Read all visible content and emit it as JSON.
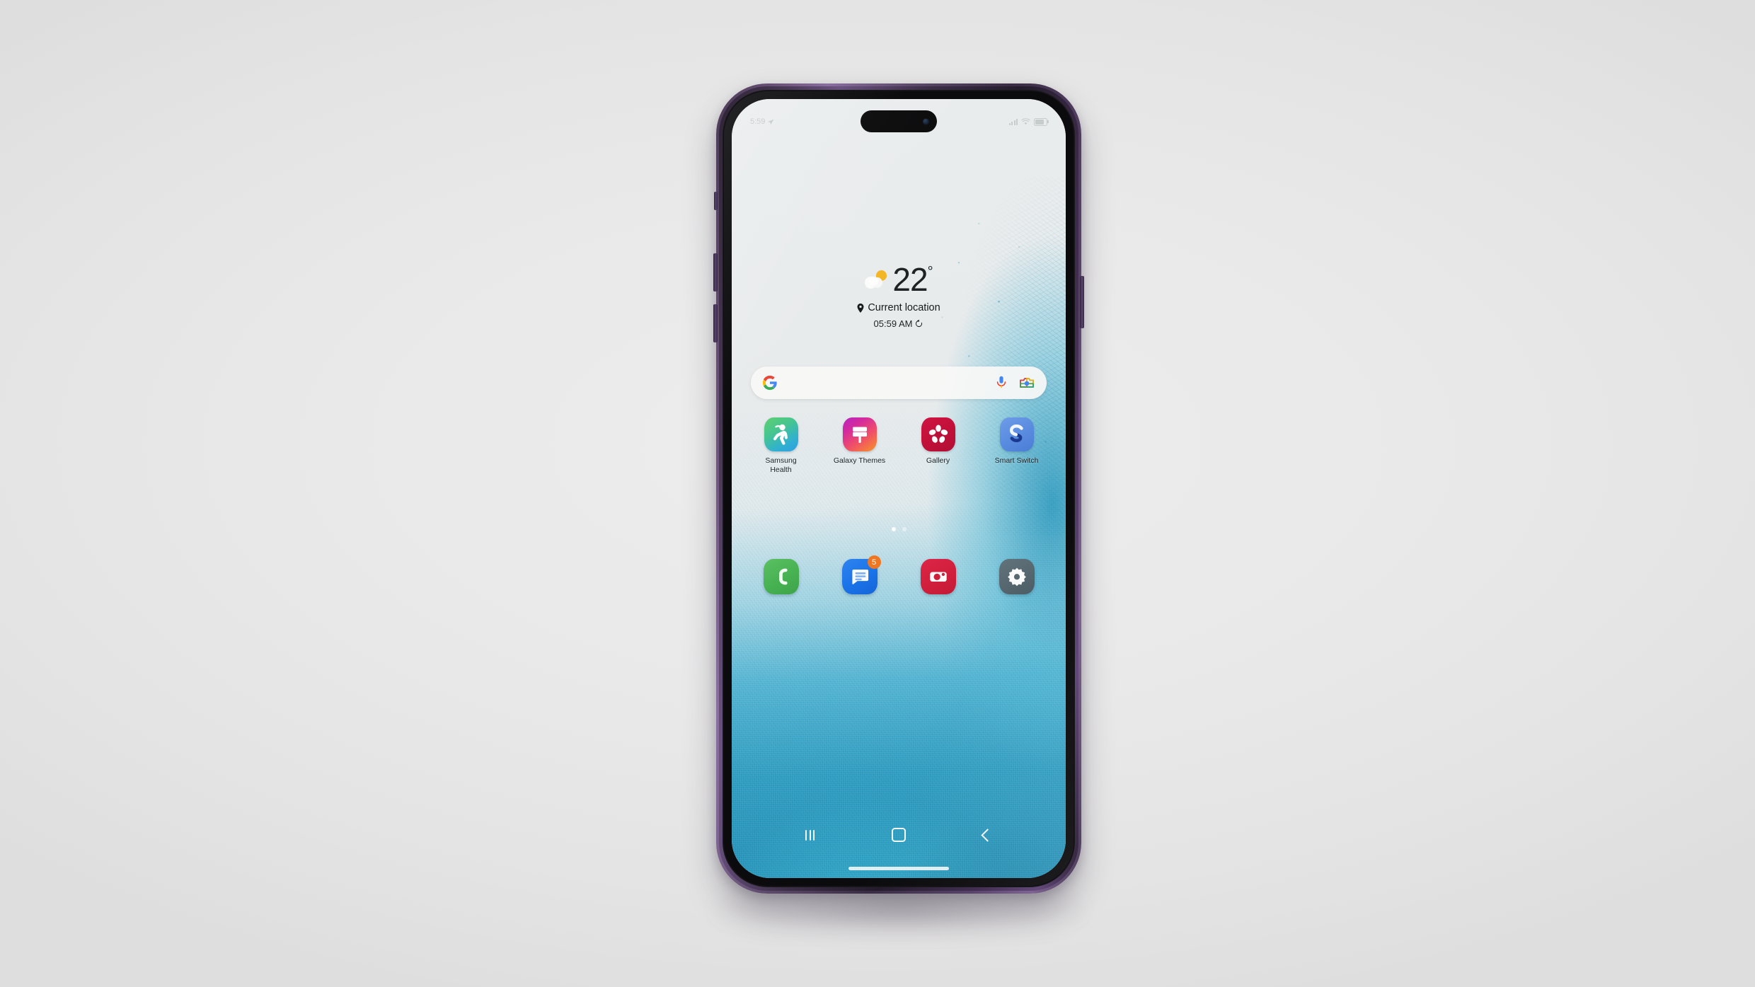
{
  "scene": {
    "subject": "smartphone-home-screen",
    "backdrop_color": "#eaeaea",
    "frame_color": "#5d4a6b"
  },
  "status_bar": {
    "time": "5:59",
    "location_icon": "location-arrow-icon",
    "signal_icon": "signal-bars-icon",
    "wifi_icon": "wifi-icon",
    "battery_icon": "battery-icon"
  },
  "weather_widget": {
    "condition_icon": "partly-cloudy-icon",
    "temperature": "22",
    "degree_symbol": "°",
    "location_icon": "location-pin-icon",
    "location": "Current location",
    "updated_time": "05:59 AM",
    "refresh_icon": "refresh-icon"
  },
  "search": {
    "logo_icon": "google-g-icon",
    "value": "",
    "placeholder": "",
    "mic_icon": "microphone-icon",
    "lens_icon": "google-lens-icon"
  },
  "apps": [
    {
      "label": "Samsung Health",
      "icon": "samsung-health-icon",
      "color_a": "#4fc46a",
      "color_b": "#2fa8e0"
    },
    {
      "label": "Galaxy Themes",
      "icon": "galaxy-themes-icon",
      "color_a": "#c42bb0",
      "color_b": "#f2703a"
    },
    {
      "label": "Gallery",
      "icon": "gallery-icon",
      "color_a": "#c6123c",
      "color_b": "#c6123c"
    },
    {
      "label": "Smart Switch",
      "icon": "smart-switch-icon",
      "color_a": "#5a8ce0",
      "color_b": "#5a8ce0"
    }
  ],
  "page_indicator": {
    "count": 2,
    "active_index": 0
  },
  "dock": [
    {
      "label": "Phone",
      "icon": "phone-icon",
      "color": "#4caf50",
      "badge": ""
    },
    {
      "label": "Messages",
      "icon": "messages-icon",
      "color": "#1a73e8",
      "badge": "5",
      "badge_color": "#ef7722"
    },
    {
      "label": "Camera",
      "icon": "camera-icon",
      "color": "#d01f3c",
      "badge": ""
    },
    {
      "label": "Settings",
      "icon": "settings-gear-icon",
      "color": "#56676f",
      "badge": ""
    }
  ],
  "nav_bar": {
    "recents_icon": "recents-icon",
    "home_icon": "home-icon",
    "back_icon": "back-icon",
    "home_indicator": "home-indicator"
  }
}
